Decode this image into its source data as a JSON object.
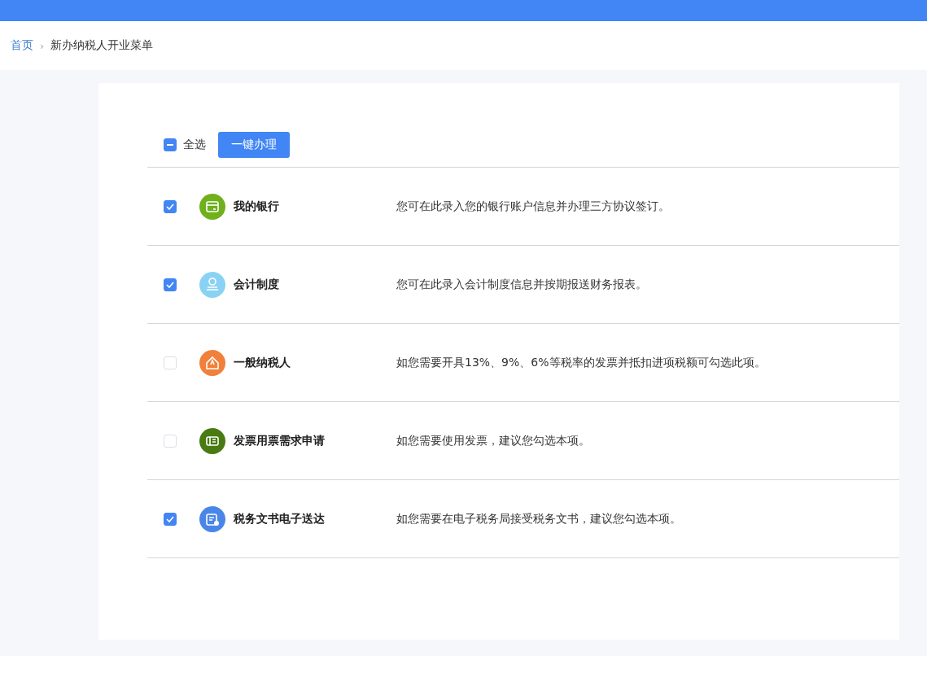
{
  "breadcrumb": {
    "home": "首页",
    "separator": "›",
    "current": "新办纳税人开业菜单"
  },
  "select_all": {
    "label": "全选",
    "indeterminate": true
  },
  "action_button": "一键办理",
  "items": [
    {
      "kind": "card",
      "color": "#6fb01c",
      "title": "我的银行",
      "description": "您可在此录入您的银行账户信息并办理三方协议签订。",
      "checked": true
    },
    {
      "kind": "person",
      "color": "#8ad2f4",
      "title": "会计制度",
      "description": "您可在此录入会计制度信息并按期报送财务报表。",
      "checked": true
    },
    {
      "kind": "house",
      "color": "#f0803a",
      "title": "一般纳税人",
      "description": "如您需要开具13%、9%、6%等税率的发票并抵扣进项税额可勾选此项。",
      "checked": false
    },
    {
      "kind": "ticket",
      "color": "#4a7a12",
      "title": "发票用票需求申请",
      "description": "如您需要使用发票，建议您勾选本项。",
      "checked": false
    },
    {
      "kind": "document",
      "color": "#4a86e8",
      "title": "税务文书电子送达",
      "description": "如您需要在电子税务局接受税务文书，建议您勾选本项。",
      "checked": true
    }
  ]
}
